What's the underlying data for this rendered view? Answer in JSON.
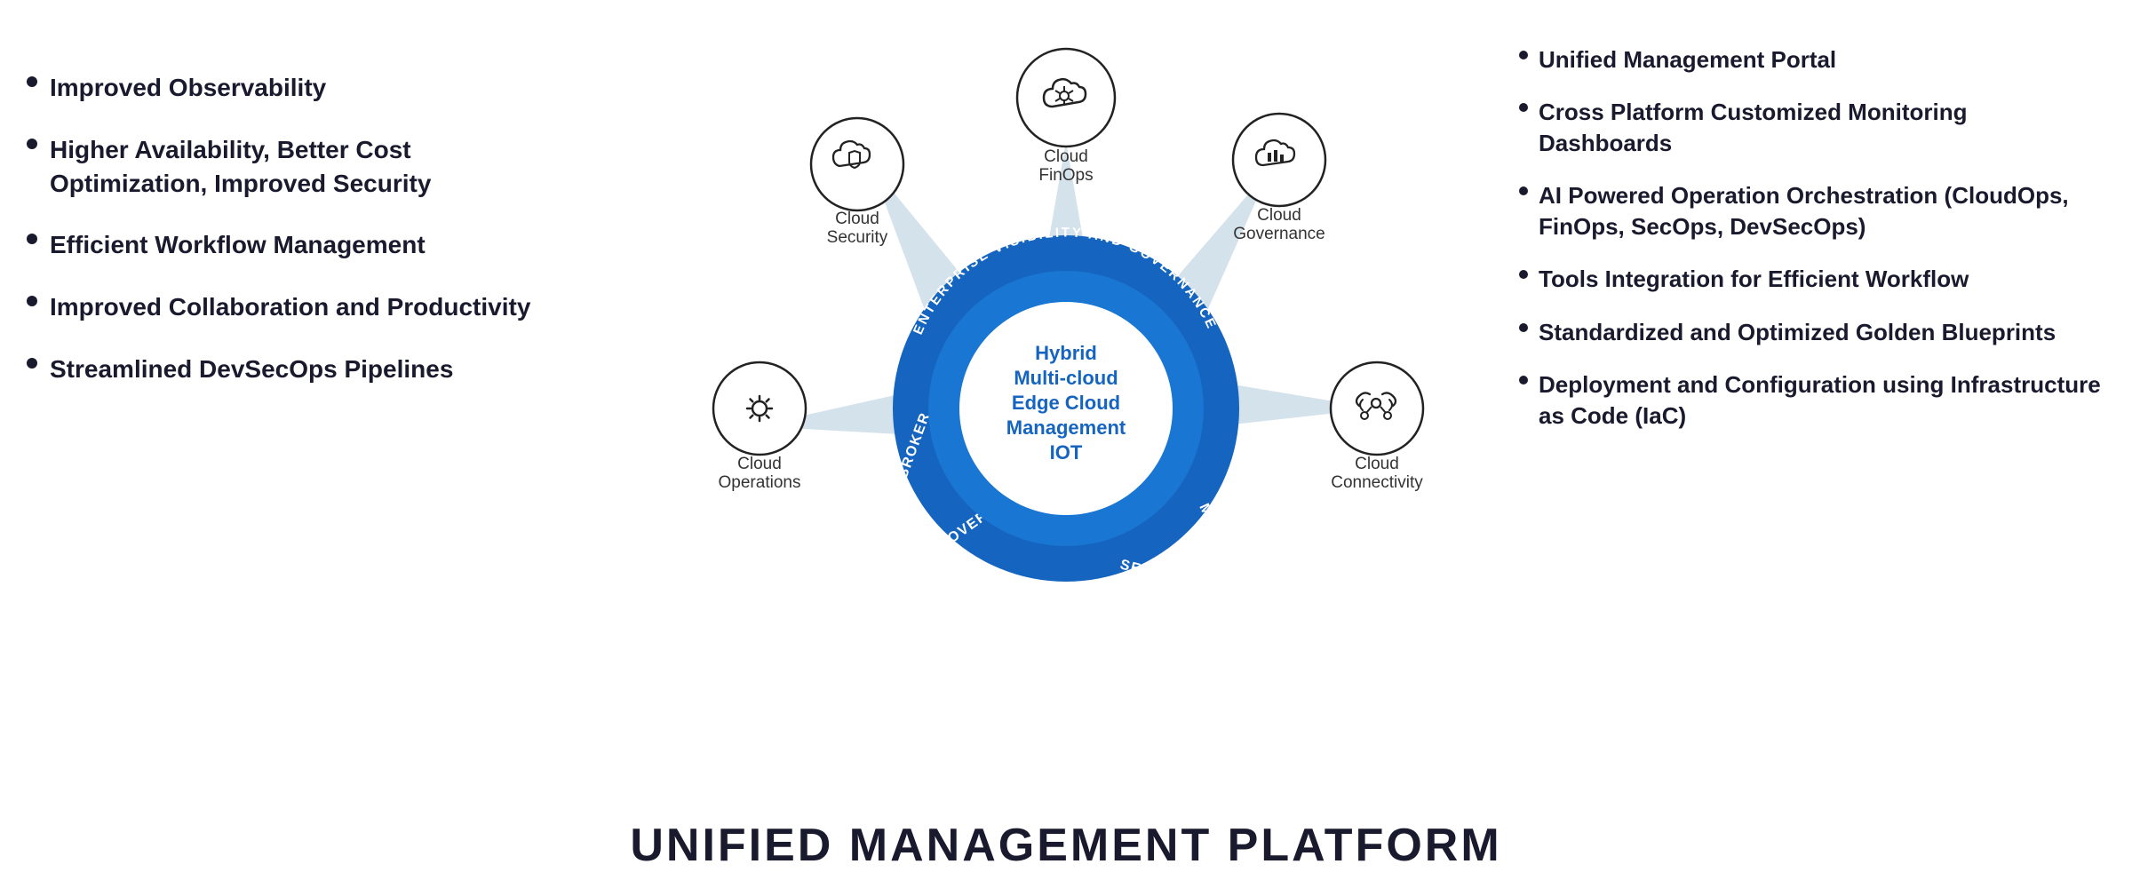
{
  "left": {
    "items": [
      {
        "text": "Improved Observability"
      },
      {
        "text": "Higher Availability, Better Cost Optimization, Improved Security"
      },
      {
        "text": "Efficient Workflow Management"
      },
      {
        "text": "Improved Collaboration and Productivity"
      },
      {
        "text": "Streamlined DevSecOps Pipelines"
      }
    ]
  },
  "right": {
    "items": [
      {
        "text": "Unified Management Portal"
      },
      {
        "text": "Cross Platform Customized Monitoring Dashboards"
      },
      {
        "text": "AI Powered Operation Orchestration (CloudOps, FinOps, SecOps, DevSecOps)"
      },
      {
        "text": "Tools Integration for Efficient Workflow"
      },
      {
        "text": "Standardized and Optimized Golden Blueprints"
      },
      {
        "text": "Deployment and Configuration using Infrastructure as Code (IaC)"
      }
    ]
  },
  "center": {
    "inner_lines": [
      "Hybrid",
      "Multi-cloud",
      "Edge Cloud",
      "Management",
      "IOT"
    ],
    "ring_text": "ENTERPRISE VISIBILITY AND GOVERNANCE",
    "ring_words": [
      "BROKER",
      "GOVERN",
      "SECURE",
      "MANAGE"
    ],
    "spokes": [
      {
        "label": "Cloud\nFinOps",
        "position": "top"
      },
      {
        "label": "Cloud\nGovernance",
        "position": "top-right"
      },
      {
        "label": "Cloud\nConnectivity",
        "position": "right"
      },
      {
        "label": "Cloud\nOperations",
        "position": "left"
      },
      {
        "label": "Cloud\nSecurity",
        "position": "top-left"
      }
    ]
  },
  "footer": {
    "title": "UNIFIED MANAGEMENT PLATFORM"
  }
}
